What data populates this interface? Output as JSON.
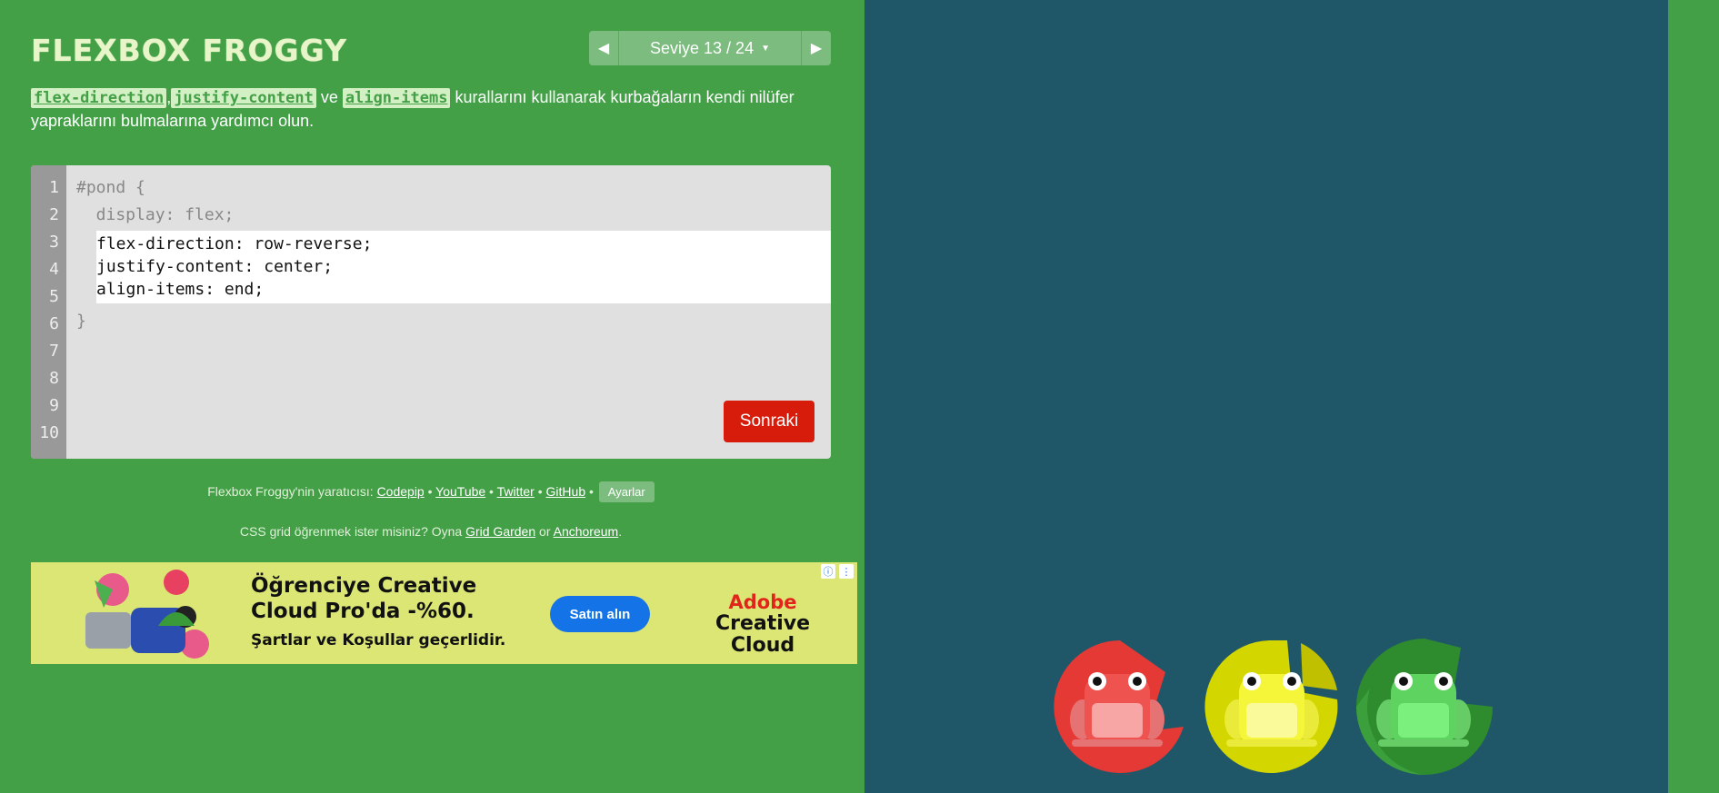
{
  "header": {
    "title": "FLEXBOX FROGGY",
    "level_label": "Seviye 13 / 24",
    "prev_icon": "triangle-left-icon",
    "next_icon": "triangle-right-icon"
  },
  "instructions": {
    "kw1": "flex-direction",
    "sep1": ",",
    "kw2": "justify-content",
    "sep2": " ve ",
    "kw3": "align-items",
    "rest": " kurallarını kullanarak kurbağaların kendi nilüfer yapraklarını bulmalarına yardımcı olun."
  },
  "editor": {
    "line_numbers": [
      "1",
      "2",
      "3",
      "4",
      "5",
      "6",
      "7",
      "8",
      "9",
      "10"
    ],
    "pre_lines": [
      "#pond {",
      "  display: flex;"
    ],
    "input_lines": [
      "flex-direction: row-reverse;",
      "justify-content: center;",
      "align-items: end;"
    ],
    "post_line": "}",
    "next_button": "Sonraki"
  },
  "credits": {
    "prefix": "Flexbox Froggy'nin yaratıcısı: ",
    "links": [
      "Codepip",
      "YouTube",
      "Twitter",
      "GitHub"
    ],
    "separator": " • ",
    "settings": "Ayarlar"
  },
  "grid_promo": {
    "prefix": "CSS grid öğrenmek ister misiniz? Oyna ",
    "link1": "Grid Garden",
    "or": " or ",
    "link2": "Anchoreum",
    "suffix": "."
  },
  "ad": {
    "headline": "Öğrenciye Creative Cloud Pro'da -%60.",
    "terms": "Şartlar ve Koşullar geçerlidir.",
    "button": "Satın alın",
    "brand_line1": "Adobe",
    "brand_line2": "Creative Cloud",
    "info_icon": "info-icon",
    "menu_icon": "more-vertical-icon"
  },
  "colors": {
    "background": "#43a047",
    "pond": "#1f5768",
    "frog_red": "#e53935",
    "frog_yellow": "#d4d600",
    "frog_green": "#2e8b2e"
  }
}
